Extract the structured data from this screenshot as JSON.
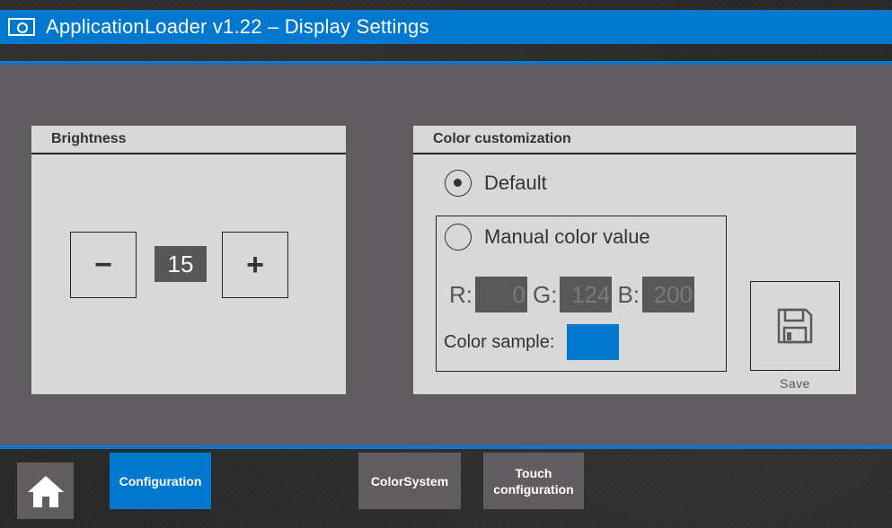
{
  "window": {
    "title": "ApplicationLoader v1.22 – Display Settings",
    "icon": "screen-icon"
  },
  "brightness": {
    "header": "Brightness",
    "minus_label": "−",
    "plus_label": "+",
    "value": "15"
  },
  "color_customization": {
    "header": "Color customization",
    "default_label": "Default",
    "default_selected": true,
    "manual_label": "Manual color value",
    "manual_selected": false,
    "r_label": "R:",
    "g_label": "G:",
    "b_label": "B:",
    "r_value": "0",
    "g_value": "124",
    "b_value": "200",
    "sample_label": "Color sample:",
    "sample_color": "#0078d0",
    "save_label": "Save",
    "save_icon": "floppy-disk-icon"
  },
  "nav": {
    "home_icon": "home-icon",
    "tabs": [
      {
        "label": "Configuration",
        "active": true
      },
      {
        "label": "ColorSystem",
        "active": false
      },
      {
        "label": "Touch configuration",
        "active": false
      }
    ]
  },
  "colors": {
    "accent": "#0078d0",
    "panel": "#d8d8d8",
    "main_bg": "#615c5f",
    "field_bg": "#585858"
  }
}
